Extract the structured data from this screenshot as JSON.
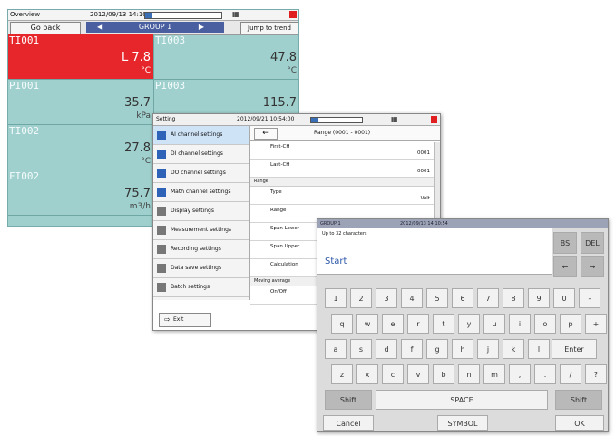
{
  "overview": {
    "title": "Overview",
    "datetime": "2012/09/13 14:10:58",
    "go_back": "Go back",
    "group_left": "◀",
    "group": "GROUP 1",
    "group_right": "▶",
    "jump_to_trend": "Jump to trend",
    "grid_icon": "grid-icon",
    "cells": [
      {
        "tag": "TI001",
        "value": "L 7.8",
        "unit": "°C",
        "alarm": true
      },
      {
        "tag": "TI003",
        "value": "47.8",
        "unit": "°C",
        "alarm": false
      },
      {
        "tag": "PI001",
        "value": "35.7",
        "unit": "kPa",
        "alarm": false
      },
      {
        "tag": "PI003",
        "value": "115.7",
        "unit": "",
        "alarm": false
      },
      {
        "tag": "TI002",
        "value": "27.8",
        "unit": "°C",
        "alarm": false
      },
      {
        "tag": "",
        "value": "",
        "unit": "",
        "alarm": false
      },
      {
        "tag": "FI002",
        "value": "75.7",
        "unit": "m3/h",
        "alarm": false
      },
      {
        "tag": "",
        "value": "",
        "unit": "",
        "alarm": false
      }
    ]
  },
  "setting": {
    "title": "Setting",
    "datetime": "2012/09/21 10:54:00",
    "back_arrow": "←",
    "range_title": "Range (0001 - 0001)",
    "menu": [
      {
        "label": "AI channel settings",
        "icon": "ai-channel-icon",
        "selected": true
      },
      {
        "label": "DI channel settings",
        "icon": "di-channel-icon",
        "selected": false
      },
      {
        "label": "DO channel settings",
        "icon": "do-channel-icon",
        "selected": false
      },
      {
        "label": "Math channel settings",
        "icon": "math-channel-icon",
        "selected": false
      },
      {
        "label": "Display settings",
        "icon": "display-icon",
        "selected": false
      },
      {
        "label": "Measurement settings",
        "icon": "measurement-icon",
        "selected": false
      },
      {
        "label": "Recording settings",
        "icon": "recording-icon",
        "selected": false
      },
      {
        "label": "Data save settings",
        "icon": "data-save-icon",
        "selected": false
      },
      {
        "label": "Batch settings",
        "icon": "batch-icon",
        "selected": false
      }
    ],
    "exit": "Exit",
    "rows": {
      "first_ch_label": "First-CH",
      "first_ch_value": "0001",
      "last_ch_label": "Last-CH",
      "last_ch_value": "0001",
      "range_section": "Range",
      "type_label": "Type",
      "type_value": "Volt",
      "range_label": "Range",
      "span_lower_label": "Span Lower",
      "span_upper_label": "Span Upper",
      "calculation_label": "Calculation",
      "moving_average_section": "Moving average",
      "onoff_label": "On/Off"
    }
  },
  "keyboard": {
    "title": "GROUP 1",
    "datetime": "2012/09/13 14:10:54",
    "hint": "Up to 32 characters",
    "input_value": "Start",
    "rows": [
      [
        "1",
        "2",
        "3",
        "4",
        "5",
        "6",
        "7",
        "8",
        "9",
        "0",
        "-"
      ],
      [
        "q",
        "w",
        "e",
        "r",
        "t",
        "y",
        "u",
        "i",
        "o",
        "p",
        "+"
      ],
      [
        "a",
        "s",
        "d",
        "f",
        "g",
        "h",
        "j",
        "k",
        "l"
      ],
      [
        "z",
        "x",
        "c",
        "v",
        "b",
        "n",
        "m",
        ",",
        ".",
        "/",
        "?"
      ]
    ],
    "enter": "Enter",
    "bs": "BS",
    "del": "DEL",
    "left": "←",
    "right": "→",
    "shift": "Shift",
    "space": "SPACE",
    "cancel": "Cancel",
    "symbol": "SYMBOL",
    "ok": "OK"
  }
}
